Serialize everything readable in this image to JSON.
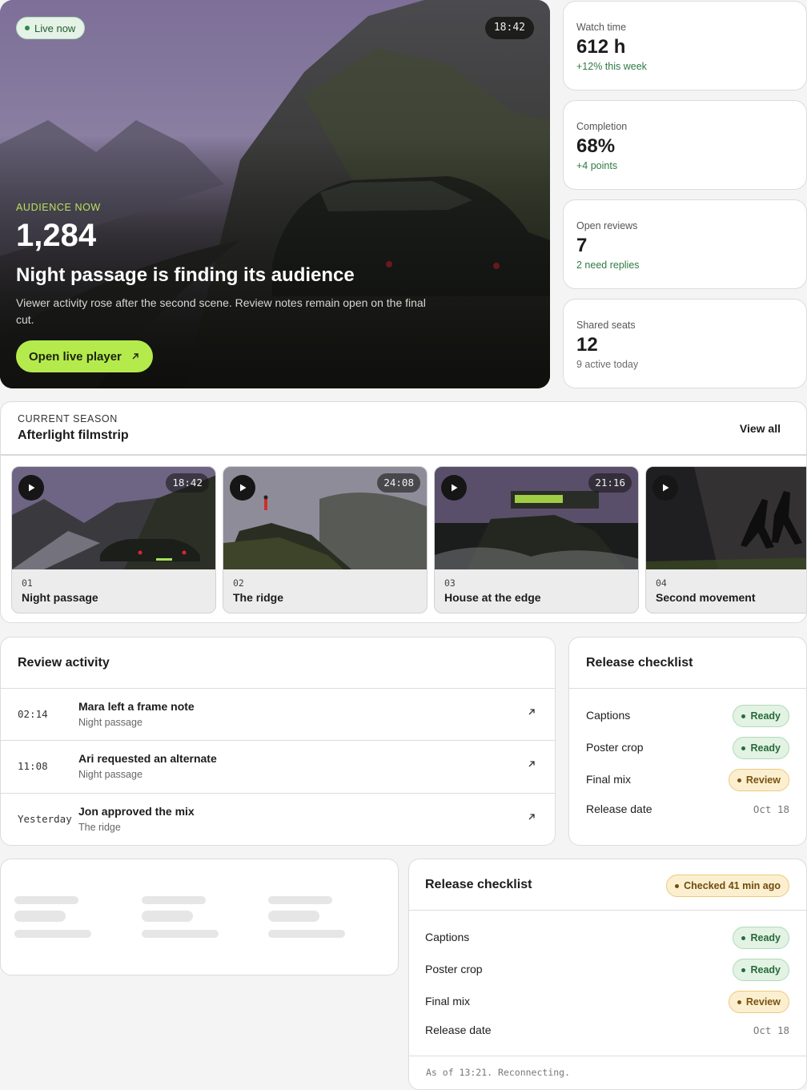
{
  "hero": {
    "live_label": "Live now",
    "timestamp": "18:42",
    "eyebrow": "AUDIENCE NOW",
    "count": "1,284",
    "title": "Night passage is finding its audience",
    "description": "Viewer activity rose after the second scene. Review notes remain open on the final cut.",
    "cta_label": "Open live player",
    "cta_icon": "arrow-up-right-icon"
  },
  "stats": [
    {
      "label": "Watch time",
      "value": "612 h",
      "delta": "+12% this week",
      "tone": "green"
    },
    {
      "label": "Completion",
      "value": "68%",
      "delta": "+4 points",
      "tone": "green"
    },
    {
      "label": "Open reviews",
      "value": "7",
      "delta": "2 need replies",
      "tone": "green"
    },
    {
      "label": "Shared seats",
      "value": "12",
      "delta": "9 active today",
      "tone": "grey"
    }
  ],
  "filmstrip": {
    "eyebrow": "CURRENT SEASON",
    "title": "Afterlight filmstrip",
    "view_all": "View all",
    "episodes": [
      {
        "number": "01",
        "title": "Night passage",
        "duration": "18:42"
      },
      {
        "number": "02",
        "title": "The ridge",
        "duration": "24:08"
      },
      {
        "number": "03",
        "title": "House at the edge",
        "duration": "21:16"
      },
      {
        "number": "04",
        "title": "Second movement",
        "duration": ""
      }
    ]
  },
  "review_activity": {
    "title": "Review activity",
    "items": [
      {
        "time": "02:14",
        "title": "Mara left a frame note",
        "subtitle": "Night passage"
      },
      {
        "time": "11:08",
        "title": "Ari requested an alternate",
        "subtitle": "Night passage"
      },
      {
        "time": "Yesterday",
        "title": "Jon approved the mix",
        "subtitle": "The ridge"
      }
    ]
  },
  "checklist_primary": {
    "title": "Release checklist",
    "items": [
      {
        "label": "Captions",
        "status": "Ready"
      },
      {
        "label": "Poster crop",
        "status": "Ready"
      },
      {
        "label": "Final mix",
        "status": "Review"
      },
      {
        "label": "Release date",
        "value": "Oct 18"
      }
    ]
  },
  "checklist_secondary": {
    "title": "Release checklist",
    "checked_badge": "Checked 41 min ago",
    "items": [
      {
        "label": "Captions",
        "status": "Ready"
      },
      {
        "label": "Poster crop",
        "status": "Ready"
      },
      {
        "label": "Final mix",
        "status": "Review"
      },
      {
        "label": "Release date",
        "value": "Oct 18"
      }
    ],
    "footer": "As of 13:21. Reconnecting."
  },
  "colors": {
    "accent_lime": "#b5ea4c",
    "ready_green": "#276b3a",
    "review_amber": "#7a5310",
    "page_background": "#f4f4f4"
  }
}
